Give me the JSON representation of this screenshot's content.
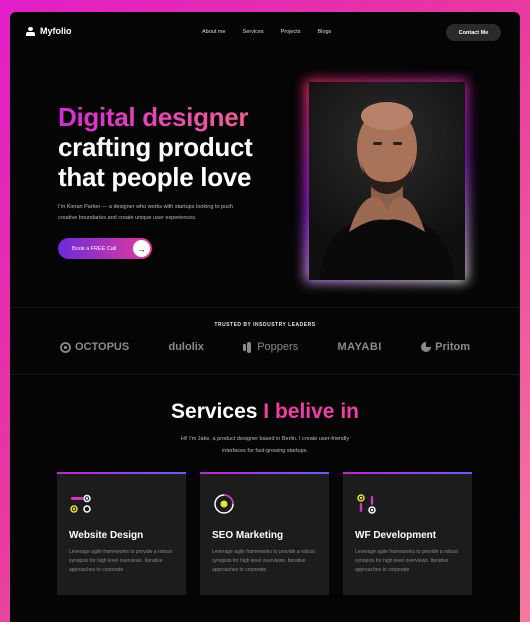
{
  "nav": {
    "logo": "Myfolio",
    "links": [
      "About me",
      "Services",
      "Projects",
      "Blogs"
    ],
    "contact": "Contact Me"
  },
  "hero": {
    "title_line1": "Digital designer",
    "title_line2": "crafting product",
    "title_line3": "that people love",
    "description": "I'm Kieran Parker — a designer who works with startups looking to push creative boundaries and create unique user experiences.",
    "cta": "Book a FREE Call"
  },
  "trusted": {
    "title": "TRUSTED BY INSDUSTRY LEADERS",
    "brands": [
      "OCTOPUS",
      "dulolix",
      "Poppers",
      "MAYABI",
      "Pritom"
    ]
  },
  "services": {
    "title_main": "Services",
    "title_accent": "I belive in",
    "description": "Hi! I'm Jake, a product designer based in Berlin. I create user-friendly interfaces for fast-growing startups.",
    "cards": [
      {
        "title": "Website Design",
        "text": "Leverage agile frameworks to provide a robust synopsis for high level overviews. Iterative approaches to corporate"
      },
      {
        "title": "SEO Marketing",
        "text": "Leverage agile frameworks to provide a robust synopsis for high level overviews. Iterative approaches to corporate"
      },
      {
        "title": "WF Development",
        "text": "Leverage agile frameworks to provide a robust synopsis for high level overviews. Iterative approaches to corporate"
      }
    ]
  },
  "colors": {
    "accent_pink": "#ef3ea4",
    "accent_purple": "#6c2bd9",
    "icon_yellow": "#e6e63a"
  }
}
